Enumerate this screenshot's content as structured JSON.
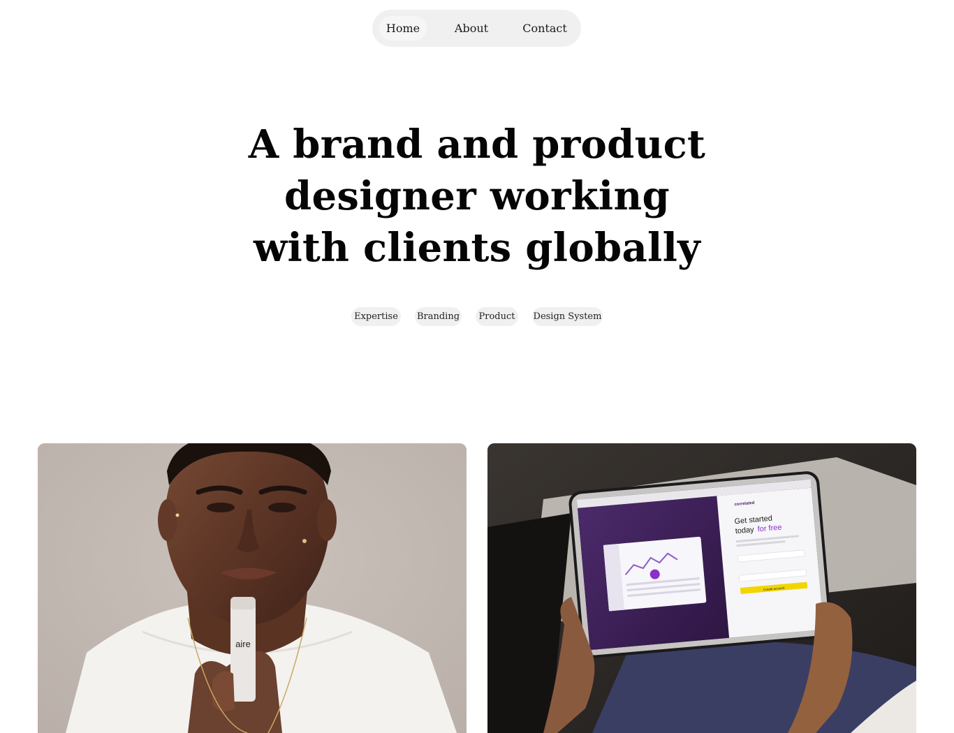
{
  "nav": {
    "items": [
      {
        "label": "Home",
        "active": true
      },
      {
        "label": "About",
        "active": false
      },
      {
        "label": "Contact",
        "active": false
      }
    ]
  },
  "hero": {
    "title_lines": [
      "A brand and product",
      "designer working",
      "with clients globally"
    ]
  },
  "tags": [
    "Expertise",
    "Branding",
    "Product",
    "Design System"
  ],
  "projects": [
    {
      "image": "portrait of man holding product bottle",
      "product_logo": "aire"
    },
    {
      "image": "hands holding tablet showing web app",
      "tablet_screen": {
        "heading_part1": "Get started",
        "heading_part2": "today",
        "heading_accent": "for free",
        "button": "Create account",
        "brand": "correlated"
      }
    }
  ],
  "colors": {
    "nav_bg": "#f1f0f0",
    "tag_bg": "#f1f0f0",
    "text": "#050505",
    "accent_purple": "#4a2466",
    "accent_yellow": "#f2d500"
  }
}
